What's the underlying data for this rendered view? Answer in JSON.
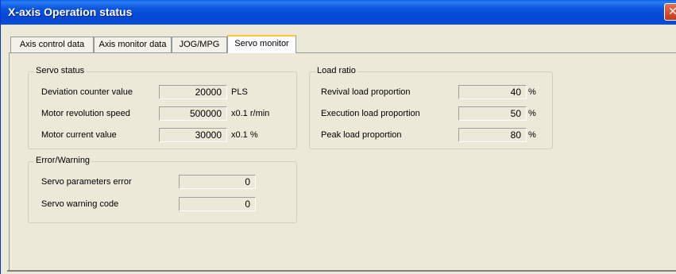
{
  "window": {
    "title": "X-axis Operation status",
    "close_glyph": "✕"
  },
  "tabs": [
    {
      "label": "Axis control data",
      "active": false
    },
    {
      "label": "Axis monitor data",
      "active": false
    },
    {
      "label": "JOG/MPG",
      "active": false
    },
    {
      "label": "Servo monitor",
      "active": true
    }
  ],
  "servo_status": {
    "title": "Servo status",
    "rows": [
      {
        "label": "Deviation counter value",
        "value": "20000",
        "unit": "PLS"
      },
      {
        "label": "Motor revolution speed",
        "value": "500000",
        "unit": "x0.1 r/min"
      },
      {
        "label": "Motor current value",
        "value": "30000",
        "unit": "x0.1 %"
      }
    ]
  },
  "load_ratio": {
    "title": "Load ratio",
    "rows": [
      {
        "label": "Revival load proportion",
        "value": "40",
        "unit": "%"
      },
      {
        "label": "Execution load proportion",
        "value": "50",
        "unit": "%"
      },
      {
        "label": "Peak load proportion",
        "value": "80",
        "unit": "%"
      }
    ]
  },
  "error_warning": {
    "title": "Error/Warning",
    "rows": [
      {
        "label": "Servo parameters error",
        "value": "0"
      },
      {
        "label": "Servo warning code",
        "value": "0"
      }
    ]
  },
  "colors": {
    "titlebar": "#0548d4",
    "active_tab_accent": "#ffc83c",
    "close_button": "#c6371b"
  },
  "icons": {
    "close": "close-icon"
  }
}
